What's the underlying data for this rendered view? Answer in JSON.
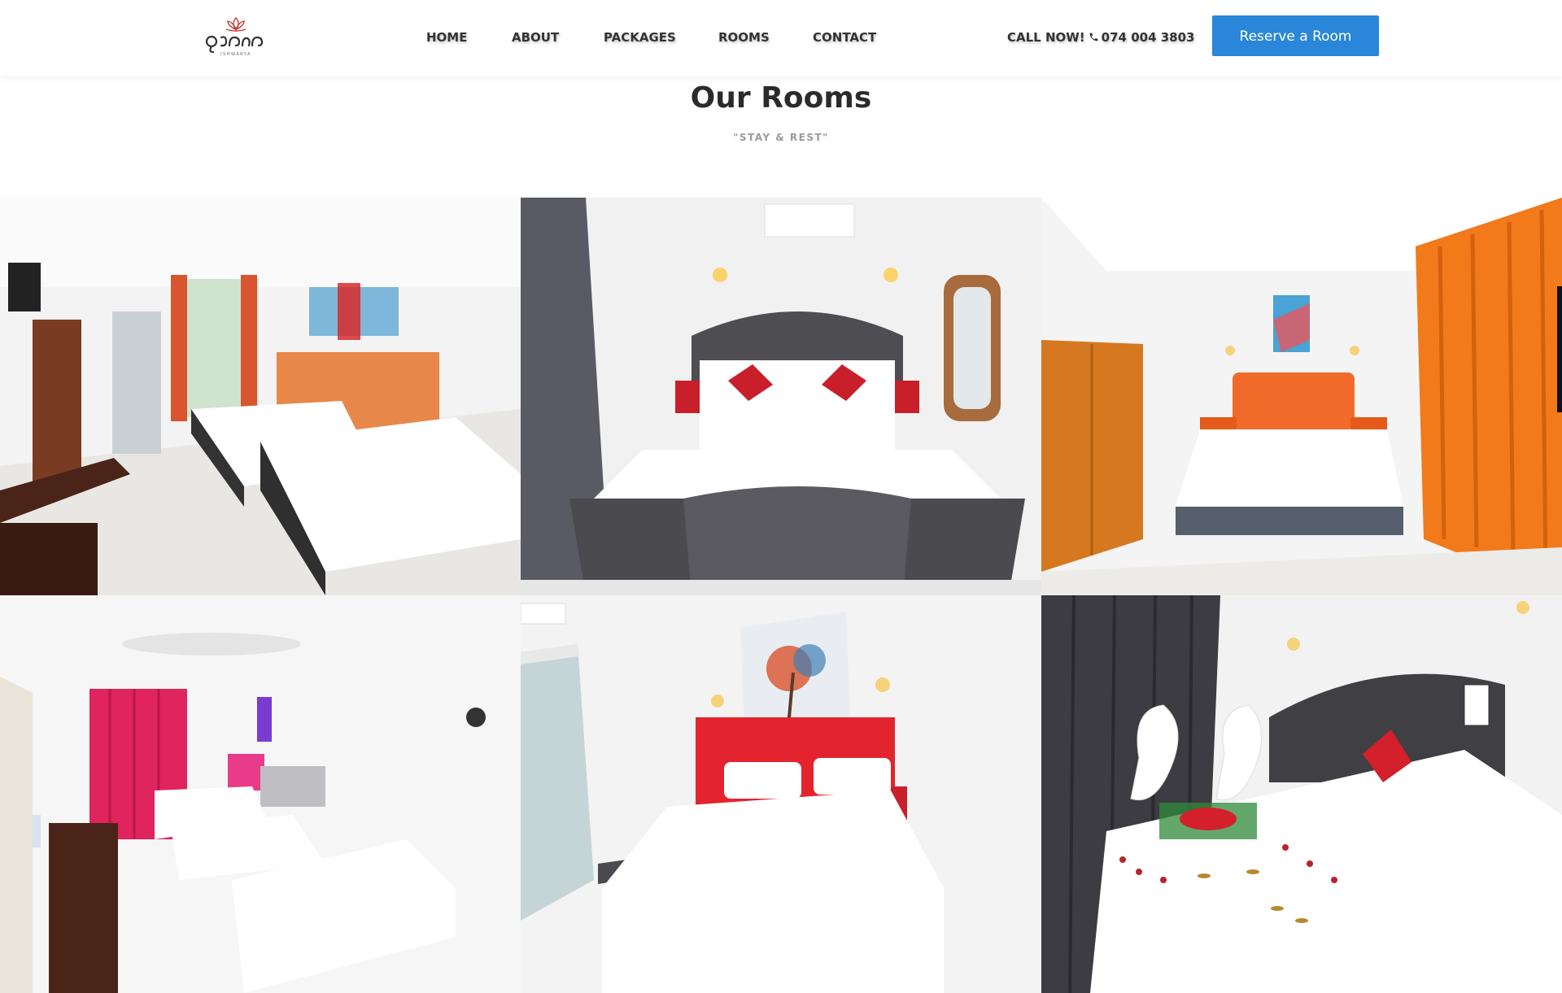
{
  "header": {
    "logo_alt": "Hotel logo",
    "nav": [
      {
        "label": "HOME"
      },
      {
        "label": "ABOUT"
      },
      {
        "label": "PACKAGES"
      },
      {
        "label": "ROOMS"
      },
      {
        "label": "CONTACT"
      }
    ],
    "call_label": "CALL NOW!",
    "phone_number": "074 004 3803",
    "reserve_label": "Reserve a Room"
  },
  "rooms_section": {
    "title": "Our Rooms",
    "subtitle": "\"STAY & REST\""
  },
  "gallery": {
    "tiles": [
      {
        "headboard": "#e8874a"
      },
      {
        "headboard": "#4d4d52"
      },
      {
        "headboard": "#f06a2a"
      },
      {
        "headboard": "#d3d3d6"
      },
      {
        "headboard": "#e3242f"
      },
      {
        "headboard": "#3f3f44"
      }
    ]
  },
  "colors": {
    "accent": "#2a86d8",
    "text_dark": "#333333",
    "subtitle_gray": "#9a9a9a"
  }
}
